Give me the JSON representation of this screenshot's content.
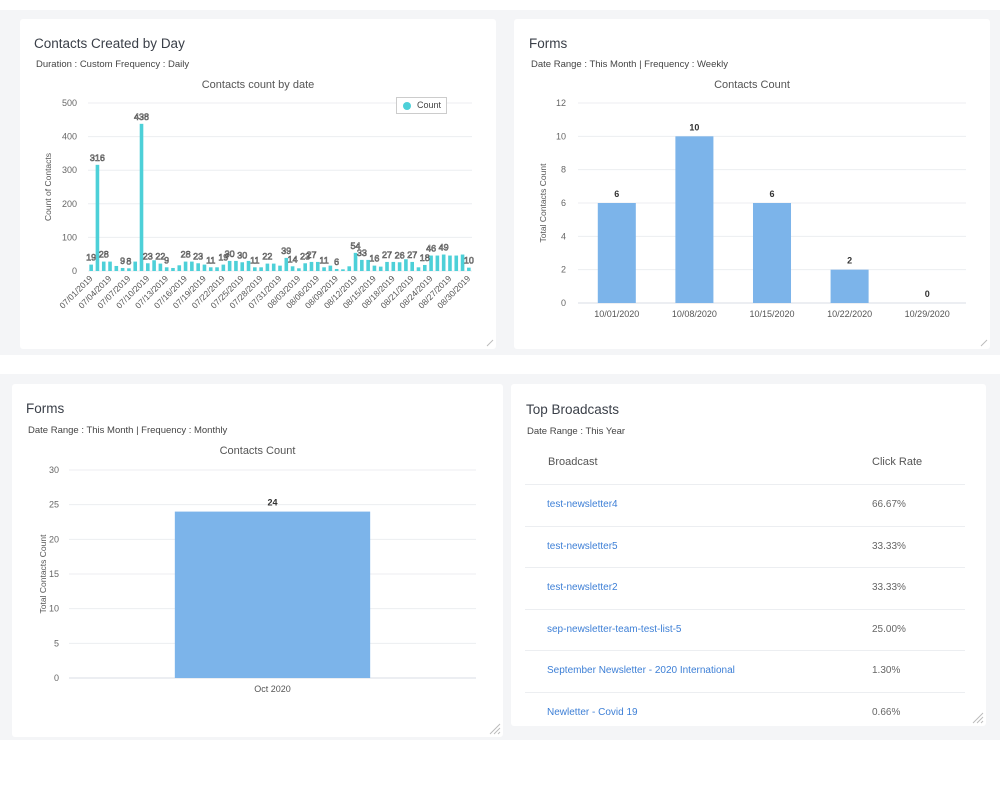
{
  "cards": {
    "daily": {
      "title": "Contacts Created by Day",
      "subtitle": "Duration : Custom Frequency : Daily",
      "chart_title": "Contacts count by date",
      "legend_label": "Count"
    },
    "weekly": {
      "title": "Forms",
      "subtitle": "Date Range : This Month | Frequency : Weekly",
      "chart_title": "Contacts Count"
    },
    "monthly": {
      "title": "Forms",
      "subtitle": "Date Range : This Month | Frequency : Monthly",
      "chart_title": "Contacts Count"
    },
    "broadcasts": {
      "title": "Top Broadcasts",
      "subtitle": "Date Range : This Year",
      "columns": [
        "Broadcast",
        "Click Rate"
      ],
      "rows": [
        {
          "name": "test-newsletter4",
          "rate": "66.67%"
        },
        {
          "name": "test-newsletter5",
          "rate": "33.33%"
        },
        {
          "name": "test-newsletter2",
          "rate": "33.33%"
        },
        {
          "name": "sep-newsletter-team-test-list-5",
          "rate": "25.00%"
        },
        {
          "name": "September Newsletter - 2020 International",
          "rate": "1.30%"
        },
        {
          "name": "Newletter - Covid 19",
          "rate": "0.66%"
        }
      ]
    }
  },
  "colors": {
    "daily_bar": "#4dd0d8",
    "form_bar": "#7cb4ea",
    "link": "#3d7fd6"
  },
  "chart_data": [
    {
      "type": "bar",
      "title": "Contacts count by date",
      "xlabel": "",
      "ylabel": "Count of Contacts",
      "ylim": [
        0,
        500
      ],
      "yticks": [
        0,
        100,
        200,
        300,
        400,
        500
      ],
      "legend": [
        "Count"
      ],
      "legend_position": "top-right",
      "grid": true,
      "xtick_labels": [
        "07/01/2019",
        "07/04/2019",
        "07/07/2019",
        "07/10/2019",
        "07/13/2019",
        "07/16/2019",
        "07/19/2019",
        "07/22/2019",
        "07/25/2019",
        "07/28/2019",
        "07/31/2019",
        "08/03/2019",
        "08/06/2019",
        "08/09/2019",
        "08/12/2019",
        "08/15/2019",
        "08/18/2019",
        "08/21/2019",
        "08/24/2019",
        "08/27/2019",
        "08/30/2019"
      ],
      "categories": [
        "07/01/2019",
        "07/02/2019",
        "07/03/2019",
        "07/04/2019",
        "07/05/2019",
        "07/06/2019",
        "07/07/2019",
        "07/08/2019",
        "07/09/2019",
        "07/10/2019",
        "07/11/2019",
        "07/12/2019",
        "07/13/2019",
        "07/14/2019",
        "07/15/2019",
        "07/16/2019",
        "07/17/2019",
        "07/18/2019",
        "07/19/2019",
        "07/20/2019",
        "07/21/2019",
        "07/22/2019",
        "07/23/2019",
        "07/24/2019",
        "07/25/2019",
        "07/26/2019",
        "07/27/2019",
        "07/28/2019",
        "07/29/2019",
        "07/30/2019",
        "07/31/2019",
        "08/01/2019",
        "08/02/2019",
        "08/03/2019",
        "08/04/2019",
        "08/05/2019",
        "08/06/2019",
        "08/07/2019",
        "08/08/2019",
        "08/09/2019",
        "08/10/2019",
        "08/11/2019",
        "08/12/2019",
        "08/13/2019",
        "08/14/2019",
        "08/15/2019",
        "08/16/2019",
        "08/17/2019",
        "08/18/2019",
        "08/19/2019",
        "08/20/2019",
        "08/21/2019",
        "08/22/2019",
        "08/23/2019",
        "08/24/2019",
        "08/25/2019",
        "08/26/2019",
        "08/27/2019",
        "08/28/2019",
        "08/29/2019",
        "08/30/2019"
      ],
      "values": [
        19,
        316,
        28,
        28,
        15,
        9,
        8,
        28,
        438,
        23,
        32,
        22,
        11,
        9,
        17,
        28,
        28,
        23,
        19,
        11,
        11,
        19,
        30,
        30,
        26,
        30,
        11,
        11,
        22,
        22,
        16,
        39,
        14,
        8,
        23,
        27,
        27,
        11,
        16,
        6,
        5,
        14,
        54,
        33,
        33,
        16,
        13,
        27,
        27,
        26,
        35,
        27,
        11,
        18,
        46,
        46,
        49,
        46,
        46,
        49,
        10
      ],
      "labeled_values": [
        "19",
        "316",
        "28",
        "9",
        "8",
        "438",
        "23",
        "22",
        "9",
        "28",
        "23",
        "11",
        "19",
        "30",
        "30",
        "11",
        "22",
        "39",
        "14",
        "23",
        "27",
        "11",
        "6",
        "54",
        "33",
        "16",
        "27",
        "26",
        "27",
        "18",
        "46",
        "49",
        "10"
      ]
    },
    {
      "type": "bar",
      "title": "Contacts Count",
      "xlabel": "",
      "ylabel": "Total Contacts Count",
      "ylim": [
        0,
        12
      ],
      "yticks": [
        0,
        2,
        4,
        6,
        8,
        10,
        12
      ],
      "grid": true,
      "categories": [
        "10/01/2020",
        "10/08/2020",
        "10/15/2020",
        "10/22/2020",
        "10/29/2020"
      ],
      "values": [
        6,
        10,
        6,
        2,
        0
      ]
    },
    {
      "type": "bar",
      "title": "Contacts Count",
      "xlabel": "",
      "ylabel": "Total Contacts Count",
      "ylim": [
        0,
        30
      ],
      "yticks": [
        0,
        5,
        10,
        15,
        20,
        25,
        30
      ],
      "grid": true,
      "categories": [
        "Oct 2020"
      ],
      "values": [
        24
      ]
    }
  ]
}
